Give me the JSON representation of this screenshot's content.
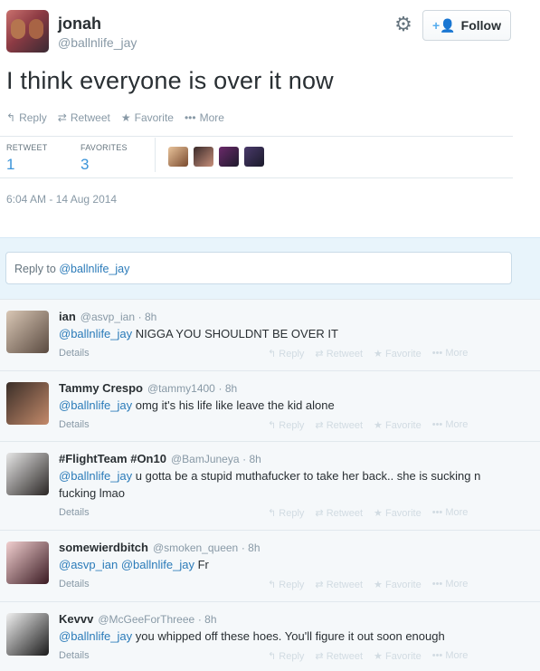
{
  "author": {
    "name": "jonah",
    "handle": "@ballnlife_jay"
  },
  "header": {
    "follow_label": "Follow",
    "gear_icon": "gear-icon",
    "follow_icon": "add-user-icon"
  },
  "tweet": {
    "text": "I think everyone is over it now",
    "timestamp": "6:04 AM - 14 Aug 2014"
  },
  "actions": {
    "reply": "Reply",
    "retweet": "Retweet",
    "favorite": "Favorite",
    "more": "More"
  },
  "stats": {
    "retweet_label": "RETWEET",
    "retweet_count": "1",
    "favorites_label": "FAVORITES",
    "favorites_count": "3"
  },
  "reply_box": {
    "prefix": "Reply to ",
    "mention": "@ballnlife_jay"
  },
  "replies": [
    {
      "name": "ian",
      "handle": "@asvp_ian",
      "time": "· 8h",
      "mention": "@ballnlife_jay",
      "text": " NIGGA YOU SHOULDNT BE OVER IT",
      "details": "Details"
    },
    {
      "name": "Tammy Crespo",
      "handle": "@tammy1400",
      "time": "· 8h",
      "mention": "@ballnlife_jay",
      "text": " omg it's his life like leave the kid alone",
      "details": "Details"
    },
    {
      "name": "#FlightTeam #On10",
      "handle": "@BamJuneya",
      "time": "· 8h",
      "mention": "@ballnlife_jay",
      "text": " u gotta be a stupid muthafucker to take her back.. she is sucking n fucking lmao",
      "details": "Details"
    },
    {
      "name": "somewierdbitch",
      "handle": "@smoken_queen",
      "time": "· 8h",
      "mention": "@asvp_ian @ballnlife_jay",
      "text": " Fr",
      "details": "Details"
    },
    {
      "name": "Kevvv",
      "handle": "@McGeeForThreee",
      "time": "· 8h",
      "mention": "@ballnlife_jay",
      "text": " you whipped off these hoes. You'll figure it out soon enough",
      "details": "Details"
    }
  ],
  "colors": {
    "link": "#2b7bb9",
    "stat": "#3b94d9",
    "muted": "#8899a6"
  }
}
